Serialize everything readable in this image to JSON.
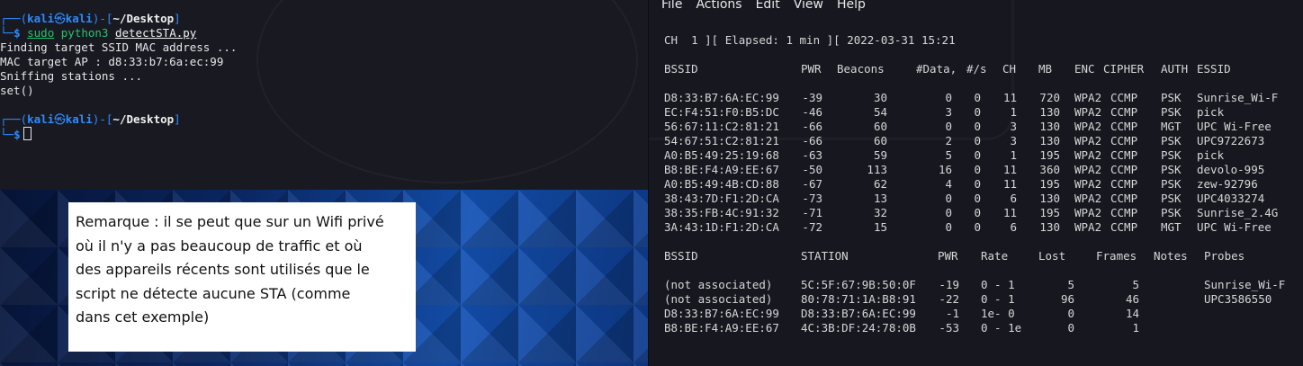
{
  "left_terminal": {
    "prompt1": {
      "open": "┌──(",
      "user": "kali",
      "at": "㉿",
      "host": "kali",
      "mid": ")-[",
      "path": "~/Desktop",
      "close": "]",
      "arrow": "└─",
      "dollar": "$",
      "cmd_sudo": "sudo",
      "cmd_py": "python3",
      "cmd_file": "detectSTA.py"
    },
    "output": [
      "Finding target SSID MAC address ...",
      "MAC target AP : d8:33:b7:6a:ec:99",
      "Sniffing stations ...",
      "set()"
    ],
    "prompt2": {
      "open": "┌──(",
      "user": "kali",
      "at": "㉿",
      "host": "kali",
      "mid": ")-[",
      "path": "~/Desktop",
      "close": "]",
      "arrow": "└─",
      "dollar": "$"
    }
  },
  "note": {
    "lines": [
      "Remarque : il se peut que sur un Wifi privé",
      "où il n'y a pas beaucoup de traffic et où",
      "des appareils récents sont utilisés que le",
      "script ne détecte aucune STA (comme",
      "dans cet exemple)"
    ]
  },
  "right_terminal": {
    "menu": [
      "File",
      "Actions",
      "Edit",
      "View",
      "Help"
    ],
    "status_line": "CH  1 ][ Elapsed: 1 min ][ 2022-03-31 15:21",
    "ap_headers": {
      "bssid": "BSSID",
      "pwr": "PWR",
      "beacons": "Beacons",
      "data": "#Data,",
      "rate": "#/s",
      "ch": "CH",
      "mb": "MB",
      "enc": "ENC",
      "cipher": "CIPHER",
      "auth": "AUTH",
      "essid": "ESSID"
    },
    "aps": [
      {
        "bssid": "D8:33:B7:6A:EC:99",
        "pwr": "-39",
        "beacons": "30",
        "data": "0",
        "rate": "0",
        "ch": "11",
        "mb": "720",
        "enc": "WPA2",
        "cipher": "CCMP",
        "auth": "PSK",
        "essid": "Sunrise_Wi-F"
      },
      {
        "bssid": "EC:F4:51:F0:B5:DC",
        "pwr": "-46",
        "beacons": "54",
        "data": "3",
        "rate": "0",
        "ch": "1",
        "mb": "130",
        "enc": "WPA2",
        "cipher": "CCMP",
        "auth": "PSK",
        "essid": "pick"
      },
      {
        "bssid": "56:67:11:C2:81:21",
        "pwr": "-66",
        "beacons": "60",
        "data": "0",
        "rate": "0",
        "ch": "3",
        "mb": "130",
        "enc": "WPA2",
        "cipher": "CCMP",
        "auth": "MGT",
        "essid": "UPC Wi-Free"
      },
      {
        "bssid": "54:67:51:C2:81:21",
        "pwr": "-66",
        "beacons": "60",
        "data": "2",
        "rate": "0",
        "ch": "3",
        "mb": "130",
        "enc": "WPA2",
        "cipher": "CCMP",
        "auth": "PSK",
        "essid": "UPC9722673"
      },
      {
        "bssid": "A0:B5:49:25:19:68",
        "pwr": "-63",
        "beacons": "59",
        "data": "5",
        "rate": "0",
        "ch": "1",
        "mb": "195",
        "enc": "WPA2",
        "cipher": "CCMP",
        "auth": "PSK",
        "essid": "pick"
      },
      {
        "bssid": "B8:BE:F4:A9:EE:67",
        "pwr": "-50",
        "beacons": "113",
        "data": "16",
        "rate": "0",
        "ch": "11",
        "mb": "360",
        "enc": "WPA2",
        "cipher": "CCMP",
        "auth": "PSK",
        "essid": "devolo-995"
      },
      {
        "bssid": "A0:B5:49:4B:CD:88",
        "pwr": "-67",
        "beacons": "62",
        "data": "4",
        "rate": "0",
        "ch": "11",
        "mb": "195",
        "enc": "WPA2",
        "cipher": "CCMP",
        "auth": "PSK",
        "essid": "zew-92796"
      },
      {
        "bssid": "38:43:7D:F1:2D:CA",
        "pwr": "-73",
        "beacons": "13",
        "data": "0",
        "rate": "0",
        "ch": "6",
        "mb": "130",
        "enc": "WPA2",
        "cipher": "CCMP",
        "auth": "PSK",
        "essid": "UPC4033274"
      },
      {
        "bssid": "38:35:FB:4C:91:32",
        "pwr": "-71",
        "beacons": "32",
        "data": "0",
        "rate": "0",
        "ch": "11",
        "mb": "195",
        "enc": "WPA2",
        "cipher": "CCMP",
        "auth": "PSK",
        "essid": "Sunrise_2.4G"
      },
      {
        "bssid": "3A:43:1D:F1:2D:CA",
        "pwr": "-72",
        "beacons": "15",
        "data": "0",
        "rate": "0",
        "ch": "6",
        "mb": "130",
        "enc": "WPA2",
        "cipher": "CCMP",
        "auth": "MGT",
        "essid": "UPC Wi-Free"
      }
    ],
    "sta_headers": {
      "bssid": "BSSID",
      "station": "STATION",
      "pwr": "PWR",
      "rate": "Rate",
      "lost": "Lost",
      "frames": "Frames",
      "notes": "Notes",
      "probes": "Probes"
    },
    "stations": [
      {
        "bssid": "(not associated)",
        "station": "5C:5F:67:9B:50:0F",
        "pwr": "-19",
        "rate": "0 - 1",
        "lost": "5",
        "frames": "5",
        "probes": "Sunrise_Wi-F"
      },
      {
        "bssid": "(not associated)",
        "station": "80:78:71:1A:B8:91",
        "pwr": "-22",
        "rate": "0 - 1",
        "lost": "96",
        "frames": "46",
        "probes": "UPC3586550"
      },
      {
        "bssid": "D8:33:B7:6A:EC:99",
        "station": "D8:33:B7:6A:EC:99",
        "pwr": "-1",
        "rate": "1e- 0",
        "lost": "0",
        "frames": "14",
        "probes": ""
      },
      {
        "bssid": "B8:BE:F4:A9:EE:67",
        "station": "4C:3B:DF:24:78:0B",
        "pwr": "-53",
        "rate": "0 - 1e",
        "lost": "0",
        "frames": "1",
        "probes": ""
      }
    ]
  }
}
